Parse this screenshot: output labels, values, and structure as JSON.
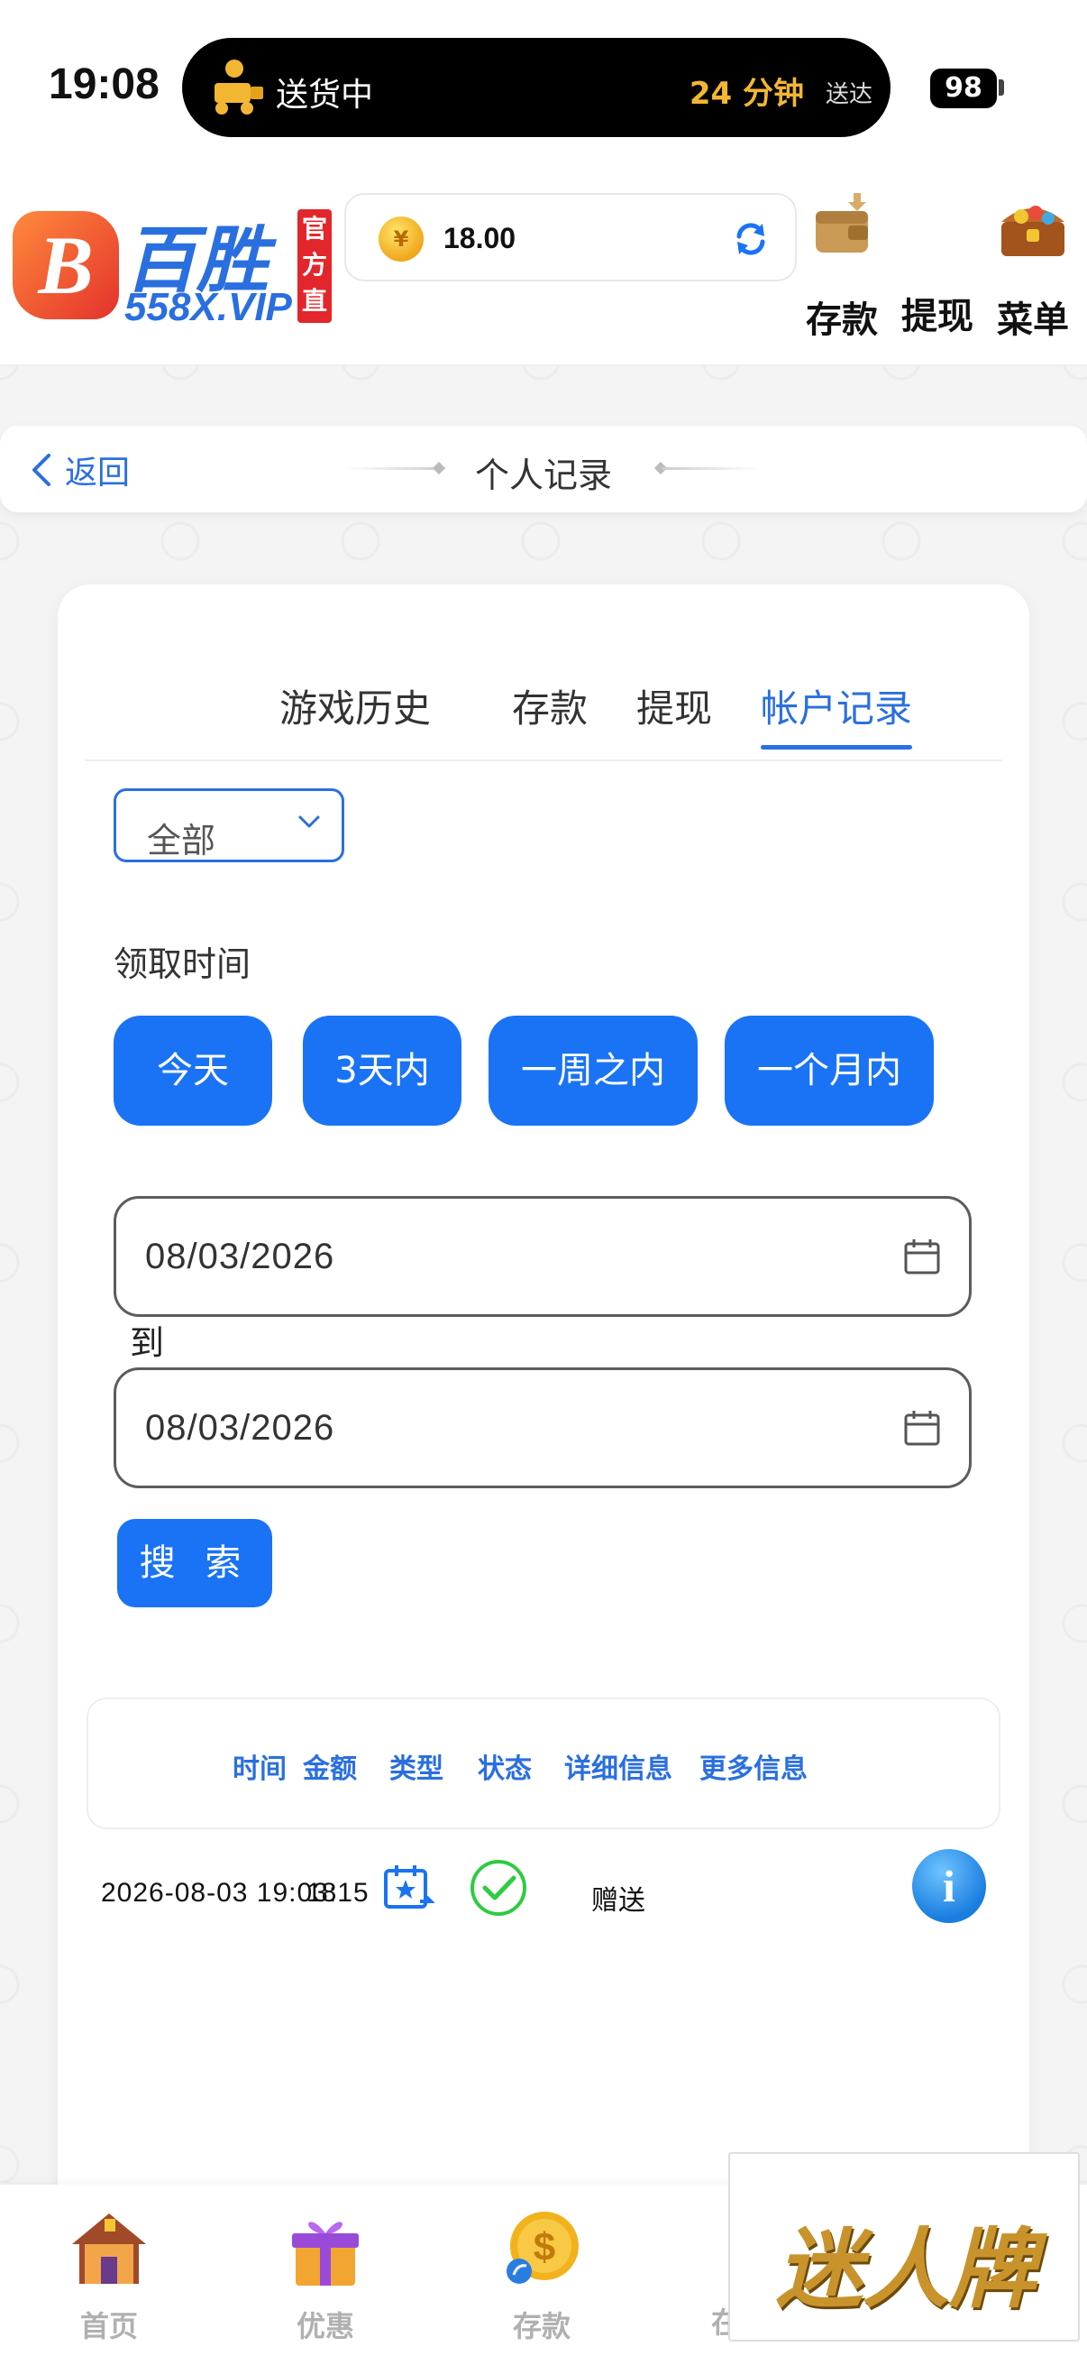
{
  "status_bar": {
    "time": "19:08",
    "island_label": "送货中",
    "island_eta": "24 分钟",
    "island_eta_suffix": "送达",
    "battery": "98"
  },
  "header": {
    "logo_title": "百胜",
    "logo_domain": "558X.VIP",
    "logo_badge": "官方直营",
    "balance": "18.00",
    "deposit_label": "存款",
    "withdraw_label": "提现",
    "menu_label": "菜单"
  },
  "navbar": {
    "back_label": "返回",
    "title": "个人记录"
  },
  "tabs": [
    {
      "label": "游戏历史",
      "active": false
    },
    {
      "label": "存款",
      "active": false
    },
    {
      "label": "提现",
      "active": false
    },
    {
      "label": "帐户记录",
      "active": true
    }
  ],
  "filter": {
    "type_select": "全部",
    "field_label": "领取时间",
    "ranges": [
      "今天",
      "3天内",
      "一周之内",
      "一个月内"
    ],
    "date_from": "08/03/2026",
    "to_label": "到",
    "date_to": "08/03/2026",
    "search_label": "搜 索"
  },
  "table": {
    "headers": [
      "时间",
      "金额",
      "类型",
      "状态",
      "详细信息",
      "更多信息"
    ],
    "rows": [
      {
        "time": "2026-08-03 19:03:15",
        "amount": "18",
        "type_icon": "calendar-star-icon",
        "status_icon": "check-circle-icon",
        "detail": "赠送",
        "more_icon": "info-icon"
      }
    ]
  },
  "bottom_nav": {
    "items": [
      "首页",
      "优惠",
      "存款",
      "在"
    ],
    "overlay_ad": "迷人牌"
  },
  "colors": {
    "accent": "#1a73f5",
    "brand_blue": "#2a6fe0",
    "status_ok": "#2ecc40",
    "eta": "#f2b632"
  }
}
